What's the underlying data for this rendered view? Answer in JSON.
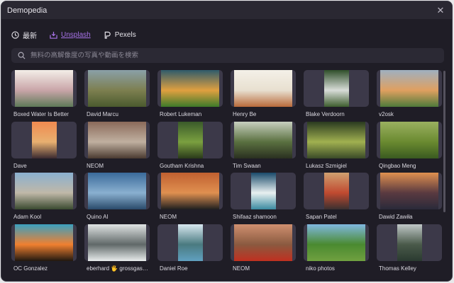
{
  "window": {
    "title": "Demopedia",
    "close": "✕"
  },
  "tabs": [
    {
      "label": "最新",
      "icon": "clock-icon"
    },
    {
      "label": "Unsplash",
      "icon": "download-tray-icon",
      "active": true
    },
    {
      "label": "Pexels",
      "icon": "pexels-icon"
    }
  ],
  "search": {
    "placeholder": "無料の高解像度の写真や動画を検索"
  },
  "accent": "#a873e8",
  "photos": [
    {
      "author": "Boxed Water Is Better",
      "orientation": "landscape",
      "colors": [
        "#f3eee8",
        "#c9a5a8",
        "#5e7a58"
      ]
    },
    {
      "author": "David Marcu",
      "orientation": "landscape",
      "colors": [
        "#8aa0a8",
        "#7d7f50",
        "#4a5a2e"
      ]
    },
    {
      "author": "Robert Lukeman",
      "orientation": "landscape",
      "colors": [
        "#2f5b6b",
        "#e0a040",
        "#3d7a2a"
      ]
    },
    {
      "author": "Henry Be",
      "orientation": "landscape",
      "colors": [
        "#f4f0e8",
        "#e8e0d0",
        "#b86a3a"
      ]
    },
    {
      "author": "Blake Verdoorn",
      "orientation": "portrait",
      "colors": [
        "#2f4f2a",
        "#d8dcd8",
        "#3d5e2e"
      ]
    },
    {
      "author": "v2osk",
      "orientation": "landscape",
      "colors": [
        "#9fb0c0",
        "#e0a060",
        "#4e7a3a"
      ]
    },
    {
      "author": "Dave",
      "orientation": "portrait",
      "colors": [
        "#f08a50",
        "#e8b070",
        "#3a2a30"
      ]
    },
    {
      "author": "NEOM",
      "orientation": "landscape",
      "colors": [
        "#8a6a5a",
        "#c0b0a0",
        "#4a3a30"
      ]
    },
    {
      "author": "Goutham Krishna",
      "orientation": "portrait",
      "colors": [
        "#3a5a2a",
        "#7aa040",
        "#2a3a1a"
      ]
    },
    {
      "author": "Tim Swaan",
      "orientation": "landscape",
      "colors": [
        "#c8d0c0",
        "#5a7040",
        "#2a3020"
      ]
    },
    {
      "author": "Lukasz Szmigiel",
      "orientation": "landscape",
      "colors": [
        "#2a3a20",
        "#a0b050",
        "#3a4a28"
      ]
    },
    {
      "author": "Qingbao Meng",
      "orientation": "landscape",
      "colors": [
        "#9ab060",
        "#6a8a30",
        "#3a5a20"
      ]
    },
    {
      "author": "Adam Kool",
      "orientation": "landscape",
      "colors": [
        "#8ab0d0",
        "#c0b8a8",
        "#3a4a30"
      ]
    },
    {
      "author": "Quino Al",
      "orientation": "landscape",
      "colors": [
        "#3a6a9a",
        "#8ab0d0",
        "#2a4a6a"
      ]
    },
    {
      "author": "NEOM",
      "orientation": "landscape",
      "colors": [
        "#c06030",
        "#e09050",
        "#202020"
      ]
    },
    {
      "author": "Shifaaz shamoon",
      "orientation": "portrait",
      "colors": [
        "#1a4a6a",
        "#e8f0f0",
        "#3a8aa0"
      ]
    },
    {
      "author": "Sapan Patel",
      "orientation": "portrait",
      "colors": [
        "#d0a070",
        "#c04a30",
        "#3a3030"
      ]
    },
    {
      "author": "Dawid Zawiła",
      "orientation": "landscape",
      "colors": [
        "#e09050",
        "#5a3a40",
        "#2a2a3a"
      ]
    },
    {
      "author": "OC Gonzalez",
      "orientation": "landscape",
      "colors": [
        "#3aa0c0",
        "#f08030",
        "#201810"
      ]
    },
    {
      "author": "eberhard 🖐 grossgasteiger",
      "orientation": "landscape",
      "colors": [
        "#e0e4e4",
        "#606868",
        "#e8ecec"
      ]
    },
    {
      "author": "Daniel Roe",
      "orientation": "portrait",
      "colors": [
        "#d8e8f0",
        "#4a7a80",
        "#60a0c0"
      ]
    },
    {
      "author": "NEOM",
      "orientation": "landscape",
      "colors": [
        "#d09070",
        "#8a5a40",
        "#c03020"
      ]
    },
    {
      "author": "niko photos",
      "orientation": "landscape",
      "colors": [
        "#80b8e0",
        "#4a8a30",
        "#70a040"
      ]
    },
    {
      "author": "Thomas Kelley",
      "orientation": "portrait",
      "colors": [
        "#c0c8c8",
        "#4a5a4a",
        "#2a3a30"
      ]
    }
  ]
}
